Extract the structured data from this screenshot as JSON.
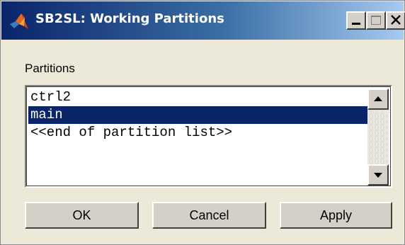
{
  "window": {
    "title": "SB2SL: Working Partitions",
    "icon": "matlab-logo-icon",
    "controls": [
      "minimize-icon",
      "maximize-icon",
      "close-icon"
    ]
  },
  "partitions": {
    "label": "Partitions",
    "items": [
      "ctrl2",
      "main",
      "<<end of partition list>>"
    ],
    "selected": "main"
  },
  "buttons": {
    "ok": "OK",
    "cancel": "Cancel",
    "apply": "Apply"
  },
  "colors": {
    "titlebar_start": "#0a246a",
    "titlebar_end": "#a6caf0",
    "selection": "#0a246a",
    "dialog_bg": "#ece9d8"
  }
}
